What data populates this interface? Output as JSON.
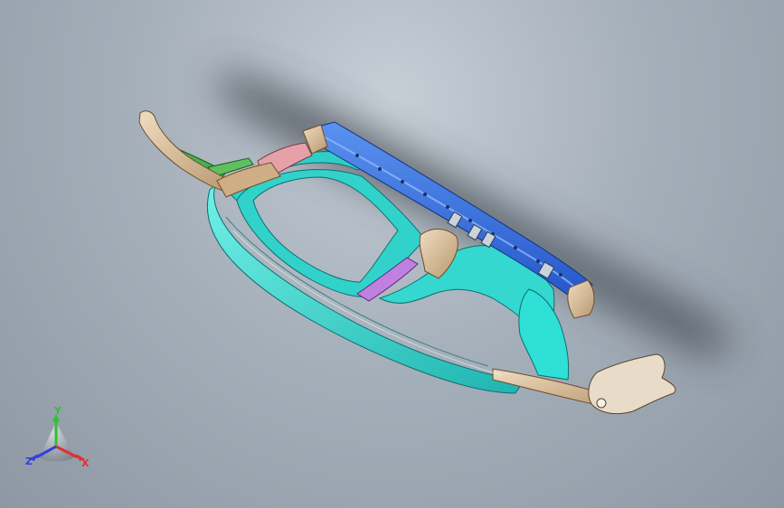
{
  "viewport": {
    "background_top": "#c6ced6",
    "background_bottom": "#8d98a4"
  },
  "model": {
    "parts": [
      {
        "name": "upper-crossmember",
        "color": "#2f6fe0"
      },
      {
        "name": "frame-outer-ring",
        "color": "#33d6cf"
      },
      {
        "name": "left-bracket-arm",
        "color": "#d9c2a0"
      },
      {
        "name": "right-bracket-arm",
        "color": "#d9c2a0"
      },
      {
        "name": "green-strut",
        "color": "#4caf50"
      },
      {
        "name": "pink-reinforcement",
        "color": "#e6a0a8"
      },
      {
        "name": "purple-reinforcement",
        "color": "#c080e0"
      },
      {
        "name": "center-pillar",
        "color": "#d9b88c"
      }
    ]
  },
  "triad": {
    "x_label": "X",
    "y_label": "Y",
    "z_label": "Z",
    "x_color": "#e03030",
    "y_color": "#30c030",
    "z_color": "#3040e0"
  }
}
